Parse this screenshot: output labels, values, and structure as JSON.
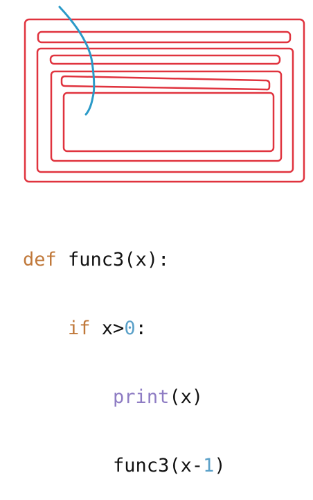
{
  "diagram": {
    "description_colors": {
      "box": "#e0333e",
      "stroke": "#2a9ac8"
    },
    "nesting_levels": 3
  },
  "code": {
    "lines": [
      {
        "kw": "def",
        "rest": " func3(x):"
      },
      {
        "indent": "    ",
        "kw": "if",
        "a": " x>",
        "num": "0",
        "b": ":"
      },
      {
        "indent": "        ",
        "bi": "print",
        "rest": "(x)"
      },
      {
        "indent": "        ",
        "a": "func3(x-",
        "num": "1",
        "b": ")"
      }
    ]
  }
}
